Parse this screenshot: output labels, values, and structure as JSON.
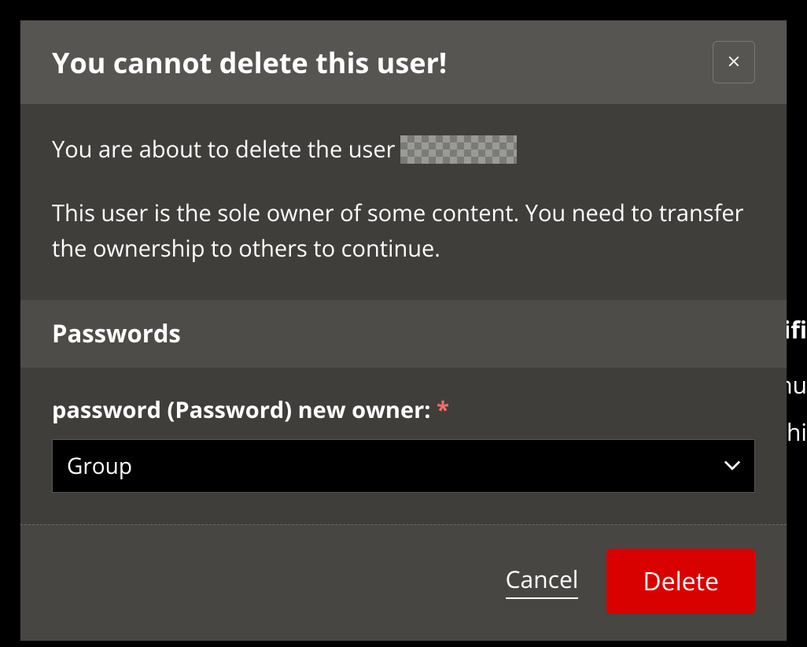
{
  "backdrop": {
    "partial_text_1": "lifi",
    "partial_text_2": "nu",
    "partial_text_3": "hi"
  },
  "modal": {
    "title": "You cannot delete this user!",
    "body": {
      "line_1_prefix": "You are about to delete the user",
      "line_2": "This user is the sole owner of some content. You need to transfer the ownership to others to continue."
    },
    "section": {
      "title": "Passwords",
      "field_label": "password (Password) new owner:",
      "required_marker": "*",
      "select_value": "Group",
      "select_options": [
        "Group"
      ]
    },
    "footer": {
      "cancel_label": "Cancel",
      "delete_label": "Delete"
    }
  }
}
